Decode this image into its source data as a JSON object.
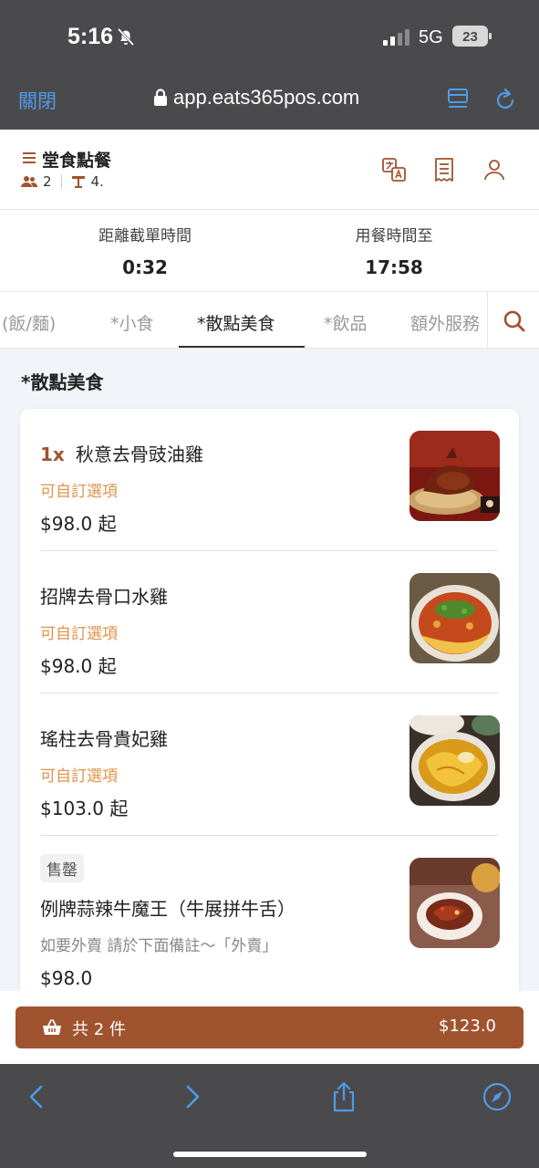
{
  "status_bar": {
    "time": "5:16",
    "network": "5G",
    "battery": "23"
  },
  "browser": {
    "close_label": "關閉",
    "url": "app.eats365pos.com"
  },
  "header": {
    "title": "堂食點餐",
    "guests": "2",
    "table": "4."
  },
  "timers": {
    "cutoff_label": "距離截單時間",
    "cutoff_value": "0:32",
    "until_label": "用餐時間至",
    "until_value": "17:58"
  },
  "categories": [
    {
      "label": "(飯/麵)",
      "active": false
    },
    {
      "label": "*小食",
      "active": false
    },
    {
      "label": "*散點美食",
      "active": true
    },
    {
      "label": "*飲品",
      "active": false
    },
    {
      "label": "額外服務",
      "active": false
    }
  ],
  "section_title": "*散點美食",
  "items": [
    {
      "qty": "1x",
      "name": "秋意去骨豉油雞",
      "option": "可自訂選項",
      "price": "$98.0 起",
      "image": "soy-chicken-photo"
    },
    {
      "qty": "",
      "name": "招牌去骨口水雞",
      "option": "可自訂選項",
      "price": "$98.0 起",
      "image": "mouthwatering-chicken-photo"
    },
    {
      "qty": "",
      "name": "瑤柱去骨貴妃雞",
      "option": "可自訂選項",
      "price": "$103.0 起",
      "image": "conpoy-chicken-photo"
    },
    {
      "qty": "",
      "badge": "售罄",
      "name": "例牌蒜辣牛魔王（牛展拼牛舌）",
      "note": "如要外賣 請於下面備註～「外賣」",
      "price": "$98.0",
      "image": "beef-shank-tongue-photo"
    }
  ],
  "cart": {
    "count_label": "共 2 件",
    "total": "$123.0"
  },
  "colors": {
    "accent": "#a0532f",
    "option": "#e0944a",
    "browser_blue": "#4f9be8",
    "chrome": "#4a4a4c"
  }
}
